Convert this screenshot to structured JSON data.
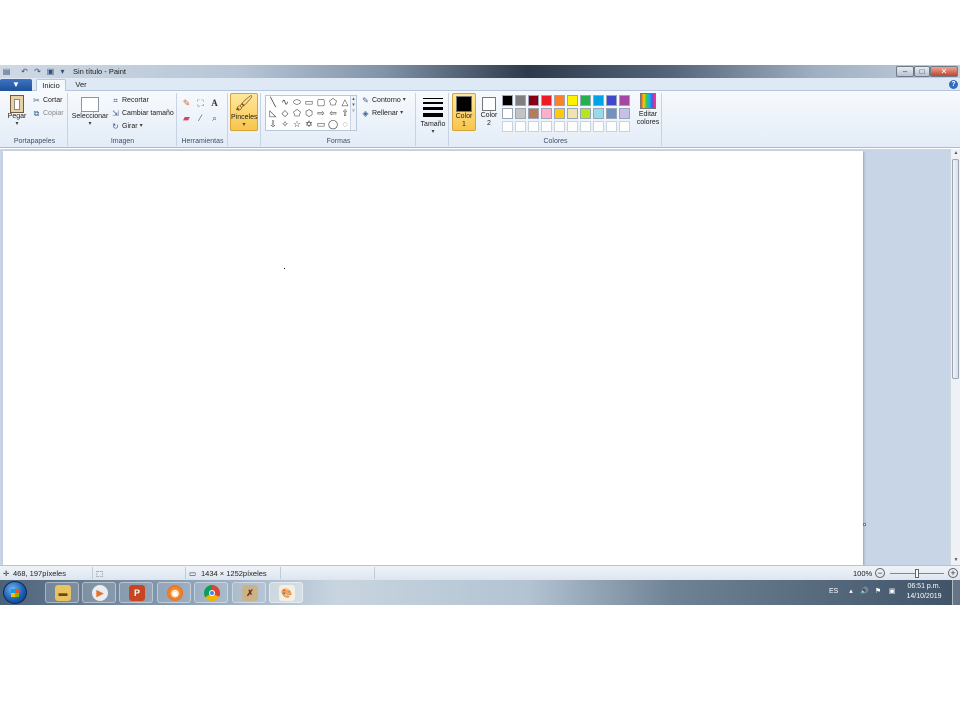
{
  "window": {
    "title": "Sin título - Paint",
    "minimize": "–",
    "maximize": "□",
    "close": "✕"
  },
  "ribbon_tabs": {
    "file": "▼",
    "tabs": [
      {
        "label": "Inicio",
        "active": true
      },
      {
        "label": "Ver",
        "active": false
      }
    ],
    "help": "?"
  },
  "groups": {
    "clipboard": {
      "label": "Portapapeles",
      "paste": "Pegar",
      "cut": "Cortar",
      "copy": "Copiar"
    },
    "image": {
      "label": "Imagen",
      "select": "Seleccionar",
      "crop": "Recortar",
      "resize": "Cambiar tamaño",
      "rotate": "Girar"
    },
    "tools": {
      "label": "Herramientas"
    },
    "brushes": {
      "label": "Pinceles"
    },
    "shapes": {
      "label": "Formas",
      "outline": "Contorno",
      "fill": "Rellenar"
    },
    "size": {
      "label": "Tamaño"
    },
    "colors": {
      "label": "Colores",
      "color1": "Color 1",
      "color2": "Color 2",
      "edit_colors": "Editar colores",
      "color1_value": "#000000",
      "color2_value": "#ffffff",
      "palette_row1": [
        "#000000",
        "#7f7f7f",
        "#880015",
        "#ed1c24",
        "#ff7f27",
        "#fff200",
        "#22b14c",
        "#00a2e8",
        "#3f48cc",
        "#a349a4"
      ],
      "palette_row2": [
        "#ffffff",
        "#c3c3c3",
        "#b97a57",
        "#ffaec9",
        "#ffc90e",
        "#efe4b0",
        "#b5e61d",
        "#99d9ea",
        "#7092be",
        "#c8bfe7"
      ]
    }
  },
  "status": {
    "cursor_pos": "468, 197píxeles",
    "canvas_size": "1434 × 1252píxeles",
    "zoom": "100%",
    "zoom_level": 0.5
  },
  "taskbar": {
    "language": "ES",
    "time": "06:51 p.m.",
    "date": "14/10/2019"
  }
}
